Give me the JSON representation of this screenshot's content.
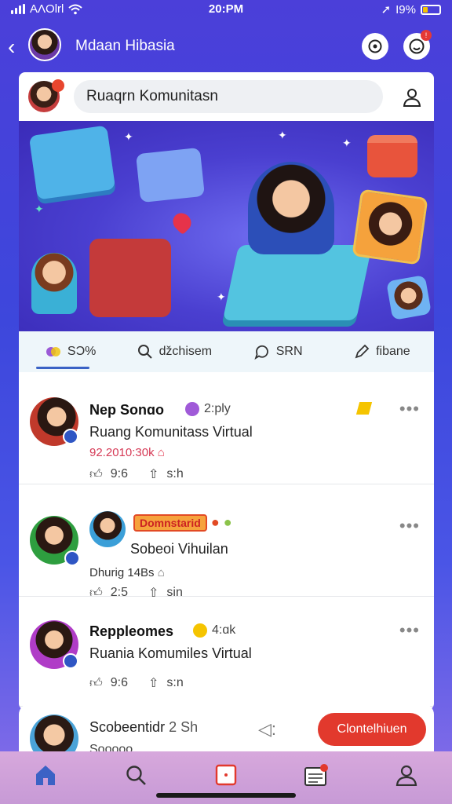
{
  "status": {
    "carrier": "AΛOlrl",
    "time": "20:PM",
    "battery": "I9%"
  },
  "header": {
    "title": "Mdaan Hibasia"
  },
  "search": {
    "placeholder": "Ruaqrn Komunitasn"
  },
  "tabs": [
    {
      "label": "SƆ%",
      "icon": "chat-bubbles-icon",
      "active": true
    },
    {
      "label": "ǆchisem",
      "icon": "search-icon",
      "active": false
    },
    {
      "label": "SRN",
      "icon": "comment-icon",
      "active": false
    },
    {
      "label": "fibane",
      "icon": "pen-icon",
      "active": false
    }
  ],
  "posts": [
    {
      "name": "Nep Sonɑo",
      "time": "2:ply",
      "text": "Ruang Komunitass Virtual",
      "sub": "92.2010:30k",
      "likes": "9:6",
      "shares": "s:h",
      "avatar_color": "#c0392b"
    },
    {
      "name": "Domnstarid",
      "time": "",
      "text": "Sobeoi Vihuilan",
      "sub": "Dhurig 14Bs",
      "likes": "2:5",
      "shares": "sin",
      "avatar_color": "#2e9e3f"
    },
    {
      "name": "Reppleomes",
      "time": "4:ɑk",
      "text": "Ruania Komumiles Virtual",
      "sub": "",
      "likes": "9:6",
      "shares": "s:n",
      "avatar_color": "#b03cc7"
    }
  ],
  "compose": {
    "title": "Scobeentidr",
    "meta": "2 Sh",
    "subtitle": "Sooooo",
    "button": "Clontelhiuen"
  },
  "colors": {
    "accent": "#3b62c5",
    "danger": "#e2392d",
    "nav": "#d7a8dc"
  },
  "nav": [
    {
      "icon": "home-icon"
    },
    {
      "icon": "search-icon"
    },
    {
      "icon": "create-icon"
    },
    {
      "icon": "inbox-icon"
    },
    {
      "icon": "profile-icon"
    }
  ]
}
